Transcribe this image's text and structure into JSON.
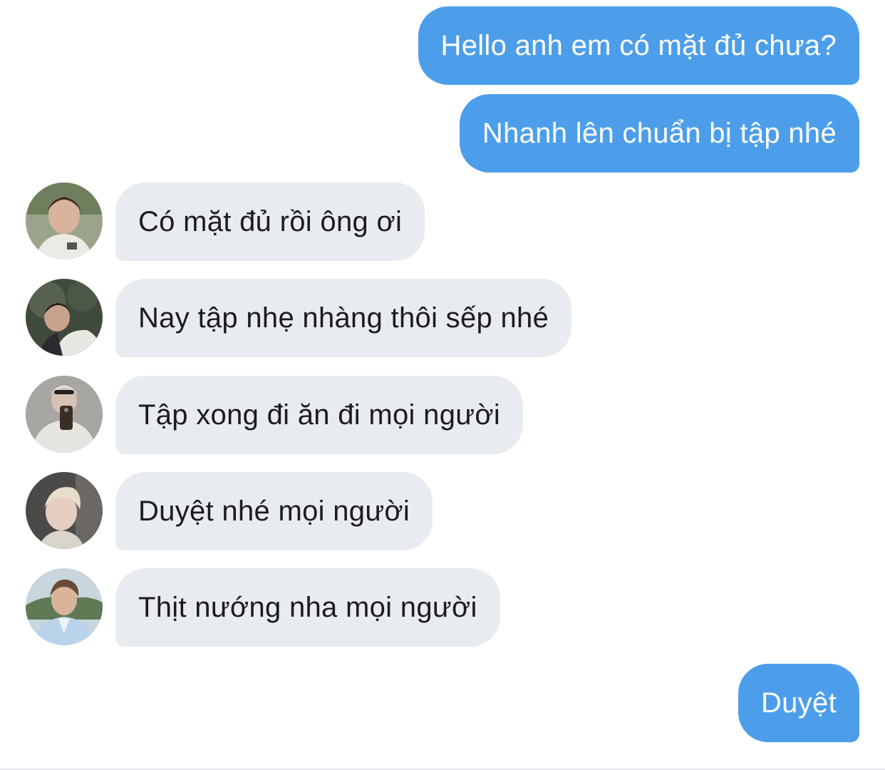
{
  "colors": {
    "outgoing_bubble": "#4d9eea",
    "incoming_bubble": "#e8ebef",
    "outgoing_text": "#ffffff",
    "incoming_text": "#1c1c1e"
  },
  "messages": [
    {
      "from": "me",
      "text": "Hello anh em có mặt đủ chưa?"
    },
    {
      "from": "me",
      "text": "Nhanh lên chuẩn bị tập nhé"
    },
    {
      "from": "member",
      "avatar": "avatar-photo",
      "text": "Có mặt đủ rồi ông ơi"
    },
    {
      "from": "member",
      "avatar": "avatar-photo",
      "text": "Nay tập nhẹ nhàng thôi sếp nhé"
    },
    {
      "from": "member",
      "avatar": "avatar-photo",
      "text": "Tập xong đi ăn đi mọi người"
    },
    {
      "from": "member",
      "avatar": "avatar-photo",
      "text": "Duyệt nhé mọi người"
    },
    {
      "from": "member",
      "avatar": "avatar-photo",
      "text": "Thịt nướng nha mọi người"
    },
    {
      "from": "me",
      "text": "Duyệt"
    }
  ]
}
